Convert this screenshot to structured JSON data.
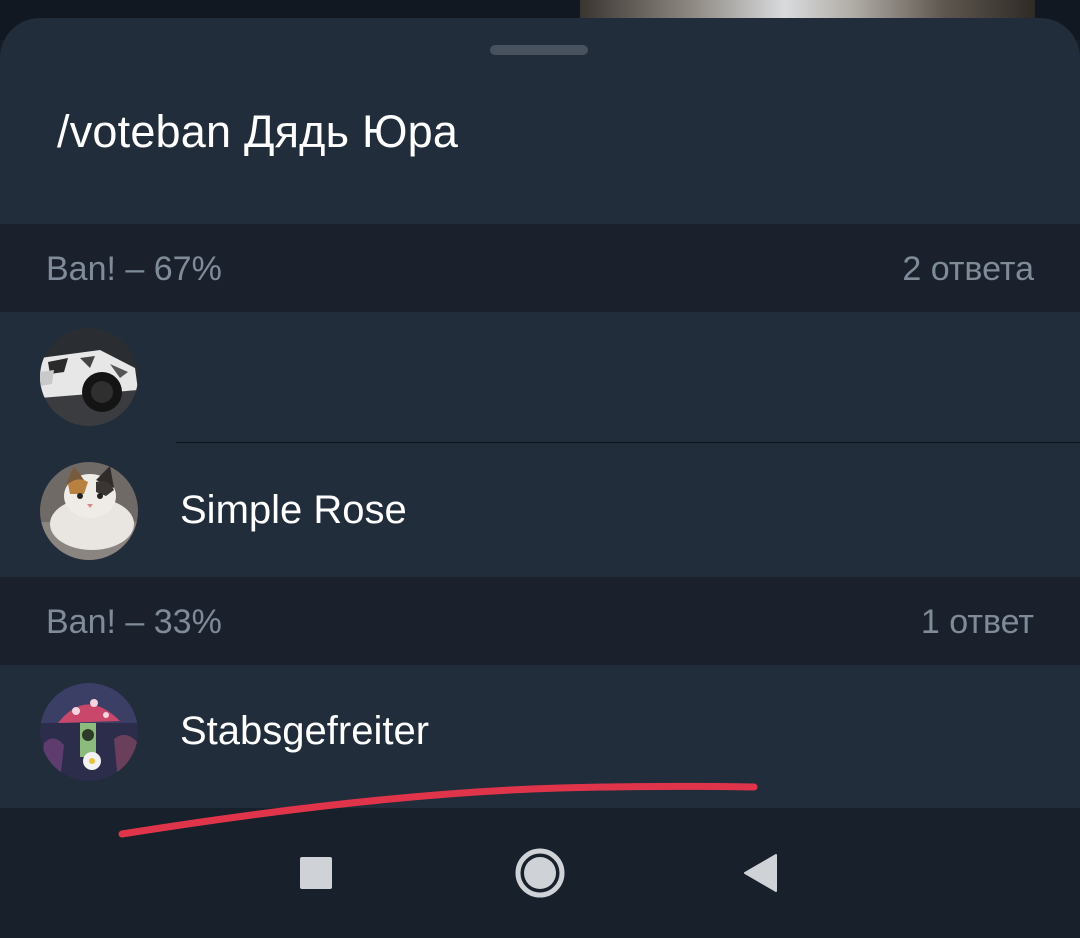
{
  "poll": {
    "title": "/voteban Дядь Юра"
  },
  "results": [
    {
      "option_label": "Ban! – 67%",
      "option_percent": 67,
      "answers_label": "2 ответа",
      "voters": [
        {
          "name": "",
          "avatar_icon": "car-avatar-icon"
        },
        {
          "name": "Simple Rose",
          "avatar_icon": "cat-avatar-icon"
        }
      ]
    },
    {
      "option_label": "Ban! – 33%",
      "option_percent": 33,
      "answers_label": "1 ответ",
      "voters": [
        {
          "name": "Stabsgefreiter",
          "avatar_icon": "mushroom-avatar-icon"
        }
      ]
    }
  ],
  "navbar": {
    "recents_icon": "square-icon",
    "home_icon": "circle-icon",
    "back_icon": "triangle-back-icon"
  },
  "colors": {
    "sheet_bg": "#222d3b",
    "section_bg": "#1a212c",
    "muted_text": "#7f8b99",
    "annotation_red": "#e0344a"
  }
}
